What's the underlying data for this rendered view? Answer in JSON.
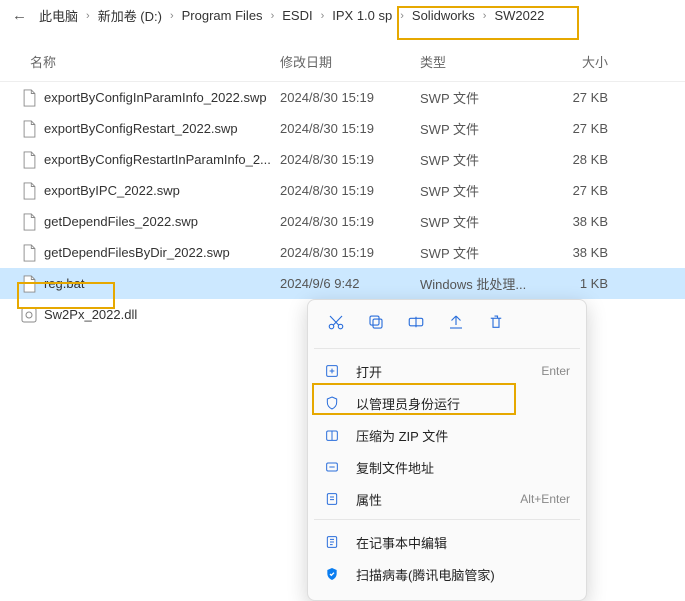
{
  "breadcrumb": {
    "items": [
      {
        "label": "此电脑"
      },
      {
        "label": "新加卷 (D:)"
      },
      {
        "label": "Program Files"
      },
      {
        "label": "ESDI"
      },
      {
        "label": "IPX 1.0 sp"
      },
      {
        "label": "Solidworks"
      },
      {
        "label": "SW2022"
      }
    ]
  },
  "columns": {
    "name": "名称",
    "date": "修改日期",
    "type": "类型",
    "size": "大小"
  },
  "files": [
    {
      "name": "exportByConfigInParamInfo_2022.swp",
      "date": "2024/8/30 15:19",
      "type": "SWP 文件",
      "size": "27 KB",
      "kind": "doc"
    },
    {
      "name": "exportByConfigRestart_2022.swp",
      "date": "2024/8/30 15:19",
      "type": "SWP 文件",
      "size": "27 KB",
      "kind": "doc"
    },
    {
      "name": "exportByConfigRestartInParamInfo_2...",
      "date": "2024/8/30 15:19",
      "type": "SWP 文件",
      "size": "28 KB",
      "kind": "doc"
    },
    {
      "name": "exportByIPC_2022.swp",
      "date": "2024/8/30 15:19",
      "type": "SWP 文件",
      "size": "27 KB",
      "kind": "doc"
    },
    {
      "name": "getDependFiles_2022.swp",
      "date": "2024/8/30 15:19",
      "type": "SWP 文件",
      "size": "38 KB",
      "kind": "doc"
    },
    {
      "name": "getDependFilesByDir_2022.swp",
      "date": "2024/8/30 15:19",
      "type": "SWP 文件",
      "size": "38 KB",
      "kind": "doc"
    },
    {
      "name": "reg.bat",
      "date": "2024/9/6 9:42",
      "type": "Windows 批处理...",
      "size": "1 KB",
      "kind": "doc",
      "selected": true
    },
    {
      "name": "Sw2Px_2022.dll",
      "date": "",
      "type": "",
      "size": "",
      "kind": "dll"
    }
  ],
  "context_menu": {
    "open": "打开",
    "open_accel": "Enter",
    "run_admin": "以管理员身份运行",
    "compress_zip": "压缩为 ZIP 文件",
    "copy_path": "复制文件地址",
    "properties": "属性",
    "properties_accel": "Alt+Enter",
    "edit_notepad": "在记事本中编辑",
    "scan_virus": "扫描病毒(腾讯电脑管家)"
  }
}
